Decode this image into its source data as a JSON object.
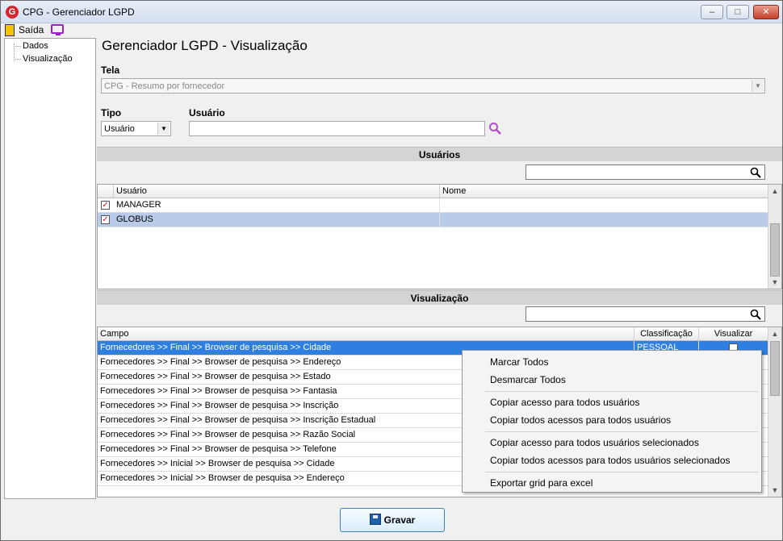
{
  "window": {
    "title": "CPG - Gerenciador LGPD",
    "app_icon_letter": "G"
  },
  "toolbar": {
    "exit_label": "Saída"
  },
  "tree": {
    "items": [
      "Dados",
      "Visualização"
    ]
  },
  "page_title": "Gerenciador LGPD - Visualização",
  "tela": {
    "label": "Tela",
    "value": "CPG - Resumo por fornecedor"
  },
  "tipo": {
    "label": "Tipo",
    "value": "Usuário"
  },
  "usuario_field": {
    "label": "Usuário",
    "value": ""
  },
  "users_section": {
    "title": "Usuários",
    "filter_value": "",
    "columns": [
      "Usuário",
      "Nome"
    ],
    "rows": [
      {
        "checked": true,
        "usuario": "MANAGER",
        "nome": ""
      },
      {
        "checked": true,
        "usuario": "GLOBUS",
        "nome": ""
      }
    ]
  },
  "view_section": {
    "title": "Visualização",
    "filter_value": "",
    "columns": [
      "Campo",
      "Classificação",
      "Visualizar"
    ],
    "rows": [
      {
        "campo": "Fornecedores >> Final >> Browser de pesquisa >> Cidade",
        "classificacao": "PESSOAL"
      },
      {
        "campo": "Fornecedores >> Final >> Browser de pesquisa >> Endereço",
        "classificacao": ""
      },
      {
        "campo": "Fornecedores >> Final >> Browser de pesquisa >> Estado",
        "classificacao": ""
      },
      {
        "campo": "Fornecedores >> Final >> Browser de pesquisa >> Fantasia",
        "classificacao": ""
      },
      {
        "campo": "Fornecedores >> Final >> Browser de pesquisa >> Inscrição",
        "classificacao": ""
      },
      {
        "campo": "Fornecedores >> Final >> Browser de pesquisa >> Inscrição Estadual",
        "classificacao": ""
      },
      {
        "campo": "Fornecedores >> Final >> Browser de pesquisa >> Razão Social",
        "classificacao": ""
      },
      {
        "campo": "Fornecedores >> Final >> Browser de pesquisa >> Telefone",
        "classificacao": ""
      },
      {
        "campo": "Fornecedores >> Inicial >> Browser de pesquisa >> Cidade",
        "classificacao": ""
      },
      {
        "campo": "Fornecedores >> Inicial >> Browser de pesquisa >> Endereço",
        "classificacao": ""
      }
    ]
  },
  "context_menu": {
    "items": [
      "Marcar Todos",
      "Desmarcar Todos",
      "Copiar acesso para todos usuários",
      "Copiar todos acessos para todos usuários",
      "Copiar acesso para todos usuários selecionados",
      "Copiar todos acessos para todos usuários selecionados",
      "Exportar grid para excel"
    ]
  },
  "save_button": {
    "label": "Gravar"
  },
  "colors": {
    "selection": "#2f7fe0",
    "row_selected": "#b8cbe9",
    "accent_purple": "#a020c8",
    "check_red": "#c0152a"
  }
}
